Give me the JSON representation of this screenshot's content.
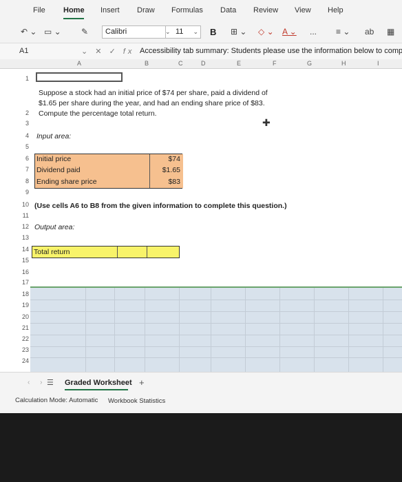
{
  "ribbon": {
    "tabs": [
      "File",
      "Home",
      "Insert",
      "Draw",
      "Formulas",
      "Data",
      "Review",
      "View",
      "Help"
    ],
    "active_tab": "Home"
  },
  "toolbar": {
    "font_name": "Calibri",
    "font_size": "11",
    "bold_label": "B",
    "more_label": "...",
    "accent_color": "#217346"
  },
  "formula_bar": {
    "name_box": "A1",
    "fx_label": "fx",
    "formula": "Accessibility tab summary: Students please use the information below to comp"
  },
  "columns": [
    "A",
    "B",
    "C",
    "D",
    "E",
    "F",
    "G",
    "H",
    "I"
  ],
  "rows": [
    "1",
    "2",
    "3",
    "4",
    "5",
    "6",
    "7",
    "8",
    "9",
    "10",
    "11",
    "12",
    "13",
    "14",
    "15",
    "16",
    "17",
    "18",
    "19",
    "20",
    "21",
    "22",
    "23",
    "24"
  ],
  "sheet": {
    "problem_line1": "Suppose a stock had an initial price of $74 per share, paid a dividend of",
    "problem_line2": "$1.65 per share during the year, and had an ending share price of $83.",
    "problem_line3": "Compute the percentage total return.",
    "input_area_label": "Input area:",
    "inputs": [
      {
        "label": "Initial price",
        "value": "$74"
      },
      {
        "label": "Dividend paid",
        "value": "$1.65"
      },
      {
        "label": "Ending share price",
        "value": "$83"
      }
    ],
    "instruction": "(Use cells A6 to B8 from the given information to complete this question.)",
    "output_area_label": "Output area:",
    "output_label": "Total return"
  },
  "sheet_tabs": {
    "active": "Graded Worksheet",
    "add_label": "+"
  },
  "status": {
    "calc_mode": "Calculation Mode: Automatic",
    "stats": "Workbook Statistics"
  }
}
